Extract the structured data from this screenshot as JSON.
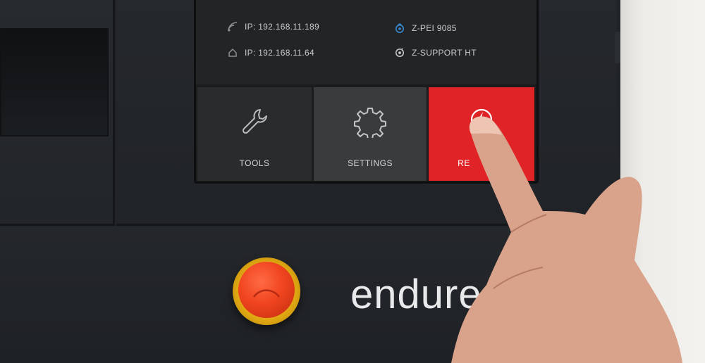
{
  "network": {
    "wifi_ip": "IP: 192.168.11.189",
    "lan_ip": "IP: 192.168.11.64"
  },
  "support": {
    "printer_id": "Z-PEI 9085",
    "support_status": "Z-SUPPORT HT"
  },
  "tiles": {
    "tools": "TOOLS",
    "settings": "SETTINGS",
    "restart_partial": "RE"
  },
  "branding": {
    "logo_text": "endure"
  },
  "colors": {
    "accent_red": "#e02326",
    "estop_red": "#f0451f",
    "estop_yellow": "#f0c21a",
    "support_blue": "#3a8fd8"
  },
  "icons": {
    "wifi": "wifi-icon",
    "ethernet": "home-network-icon",
    "printer": "printer-status-icon",
    "support": "support-icon",
    "tools": "wrench-icon",
    "settings": "gear-icon",
    "restart": "power-bolt-icon"
  }
}
